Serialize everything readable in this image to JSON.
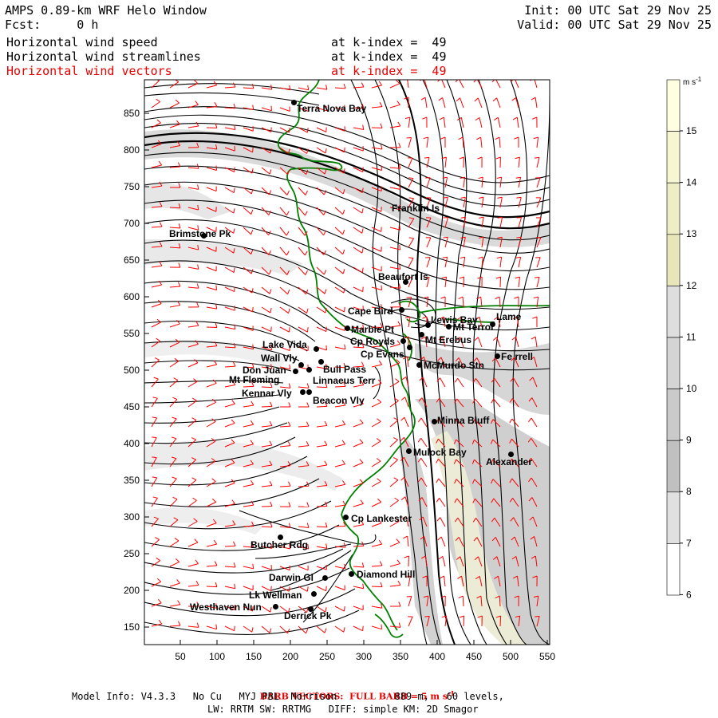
{
  "header": {
    "title": "AMPS 0.89-km WRF Helo Window",
    "fcst": "Fcst:     0 h",
    "init": "Init: 00 UTC Sat 29 Nov 25",
    "valid": "Valid: 00 UTC Sat 29 Nov 25",
    "fields": [
      {
        "name": "Horizontal wind speed",
        "level": "at k-index =  49"
      },
      {
        "name": "Horizontal wind streamlines",
        "level": "at k-index =  49"
      },
      {
        "name": "Horizontal wind vectors",
        "level": "at k-index =  49"
      }
    ]
  },
  "axes": {
    "x_ticks": [
      "50",
      "100",
      "150",
      "200",
      "250",
      "300",
      "350",
      "400",
      "450",
      "500",
      "550"
    ],
    "y_ticks": [
      "850",
      "800",
      "750",
      "700",
      "650",
      "600",
      "550",
      "500",
      "450",
      "400",
      "350",
      "300",
      "250",
      "200",
      "150"
    ]
  },
  "colorbar": {
    "unit": "m s-1",
    "ticks": [
      "15",
      "14",
      "13",
      "12",
      "11",
      "10",
      "9",
      "8",
      "7",
      "6"
    ],
    "colors": [
      "#fefee0",
      "#f6f6d2",
      "#eeeec6",
      "#e6e6ba",
      "#dedede",
      "#d4d4d4",
      "#cacaca",
      "#c0c0c0",
      "#e0e0e0",
      "#ffffff"
    ]
  },
  "places": [
    {
      "label": "Terra Nova Bay"
    },
    {
      "label": "Franklin Is"
    },
    {
      "label": "Brimstone Pk"
    },
    {
      "label": "Beaufort Is"
    },
    {
      "label": "Cape Bird"
    },
    {
      "label": "Lewis Bay"
    },
    {
      "label": "Lame"
    },
    {
      "label": "Mt Terror"
    },
    {
      "label": "Marble Pt"
    },
    {
      "label": "Cp Royds"
    },
    {
      "label": "Mt Erebus"
    },
    {
      "label": "Lake Vida"
    },
    {
      "label": "Cp Evans"
    },
    {
      "label": "Fe rrell"
    },
    {
      "label": "Wall Vly"
    },
    {
      "label": "McMurdo Stn"
    },
    {
      "label": "Don Juan"
    },
    {
      "label": "Bull Pass"
    },
    {
      "label": "Mt Fleming"
    },
    {
      "label": "Linnaeus Terr"
    },
    {
      "label": "Kennar Vly"
    },
    {
      "label": "Beacon Vly"
    },
    {
      "label": "Minna Bluff"
    },
    {
      "label": "Mulock Bay"
    },
    {
      "label": "Alexander"
    },
    {
      "label": "Cp Lankester"
    },
    {
      "label": "Butcher Rdg"
    },
    {
      "label": "Darwin Gl"
    },
    {
      "label": "Diamond Hill"
    },
    {
      "label": "Lk Wellman"
    },
    {
      "label": "Westhaven Nun"
    },
    {
      "label": "Derrick Pk"
    }
  ],
  "footer": {
    "barb_note": "BARB VECTORS:  FULL BARB = 5 m s",
    "barb_exp": "-1",
    "model_line": "Model Info: V4.3.3   No Cu   MYJ PBL  Morrison          889 m,   60 levels,",
    "physics_line": "LW: RRTM SW: RRTMG   DIFF: simple KM: 2D Smagor"
  },
  "colors": {
    "barbs": "#ff0000",
    "coast": "#008000",
    "streamlines": "#000000"
  }
}
